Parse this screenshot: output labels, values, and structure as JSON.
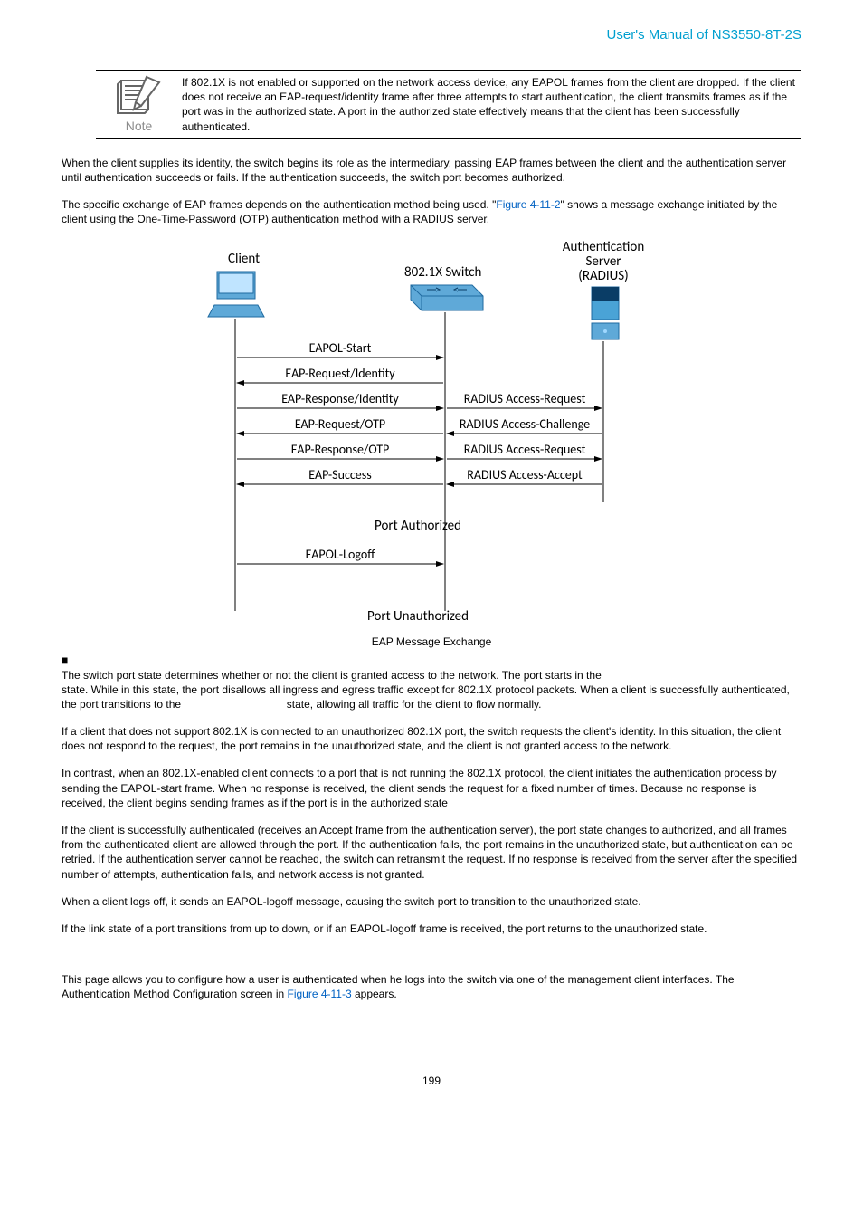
{
  "header": {
    "title": "User's Manual of NS3550-8T-2S"
  },
  "note": {
    "label": "Note",
    "text": "If 802.1X is not enabled or supported on the network access device, any EAPOL frames from the client are dropped. If the client does not receive an EAP-request/identity frame after three attempts to start authentication, the client transmits frames as if the port was in the authorized state. A port in the authorized state effectively means that the client has been successfully authenticated."
  },
  "para1": "When the client supplies its identity, the switch begins its role as the intermediary, passing EAP frames between the client and the authentication server until authentication succeeds or fails. If the authentication succeeds, the switch port becomes authorized.",
  "para2a": "The specific exchange of EAP frames depends on the authentication method being used. \"",
  "para2_link": "Figure 4-11-2",
  "para2b": "\" shows a message exchange initiated by the client using the One-Time-Password (OTP) authentication method with a RADIUS server.",
  "diagram": {
    "client": "Client",
    "switch": "802.1X Switch",
    "server_l1": "Authentication",
    "server_l2": "Server",
    "server_l3": "(RADIUS)",
    "eapol_start": "EAPOL-Start",
    "eap_req_id": "EAP-Request/Identity",
    "eap_res_id": "EAP-Response/Identity",
    "eap_req_otp": "EAP-Request/OTP",
    "eap_res_otp": "EAP-Response/OTP",
    "eap_success": "EAP-Success",
    "r_req1": "RADIUS Access-Request",
    "r_chal": "RADIUS Access-Challenge",
    "r_req2": "RADIUS Access-Request",
    "r_acc": "RADIUS Access-Accept",
    "port_auth": "Port Authorized",
    "eapol_logoff": "EAPOL-Logoff",
    "port_unauth": "Port Unauthorized"
  },
  "caption": "EAP Message Exchange",
  "bullet_marker": "■",
  "para3a": "The switch port state determines whether or not the client is granted access to the network. The port starts in the",
  "para3b": "state. While in this state, the port disallows all ingress and egress traffic except for 802.1X protocol packets. When a client is successfully authenticated, the port transitions to the",
  "para3c": "state, allowing all traffic for the client to flow normally.",
  "para4": "If a client that does not support 802.1X is connected to an unauthorized 802.1X port, the switch requests the client's identity. In this situation, the client does not respond to the request, the port remains in the unauthorized state, and the client is not granted access to the network.",
  "para5": "In contrast, when an 802.1X-enabled client connects to a port that is not running the 802.1X protocol, the client initiates the authentication process by sending the EAPOL-start frame. When no response is received, the client sends the request for a fixed number of times. Because no response is received, the client begins sending frames as if the port is in the authorized state",
  "para6": "If the client is successfully authenticated (receives an Accept frame from the authentication server), the port state changes to authorized, and all frames from the authenticated client are allowed through the port. If the authentication fails, the port remains in the unauthorized state, but authentication can be retried. If the authentication server cannot be reached, the switch can retransmit the request. If no response is received from the server after the specified number of attempts, authentication fails, and network access is not granted.",
  "para7": "When a client logs off, it sends an EAPOL-logoff message, causing the switch port to transition to the unauthorized state.",
  "para8": "If the link state of a port transitions from up to down, or if an EAPOL-logoff frame is received, the port returns to the unauthorized state.",
  "para9a": "This page allows you to configure how a user is authenticated when he logs into the switch via one of the management client interfaces. The Authentication Method Configuration screen in ",
  "para9_link": "Figure 4-11-3",
  "para9b": " appears.",
  "page_number": "199"
}
